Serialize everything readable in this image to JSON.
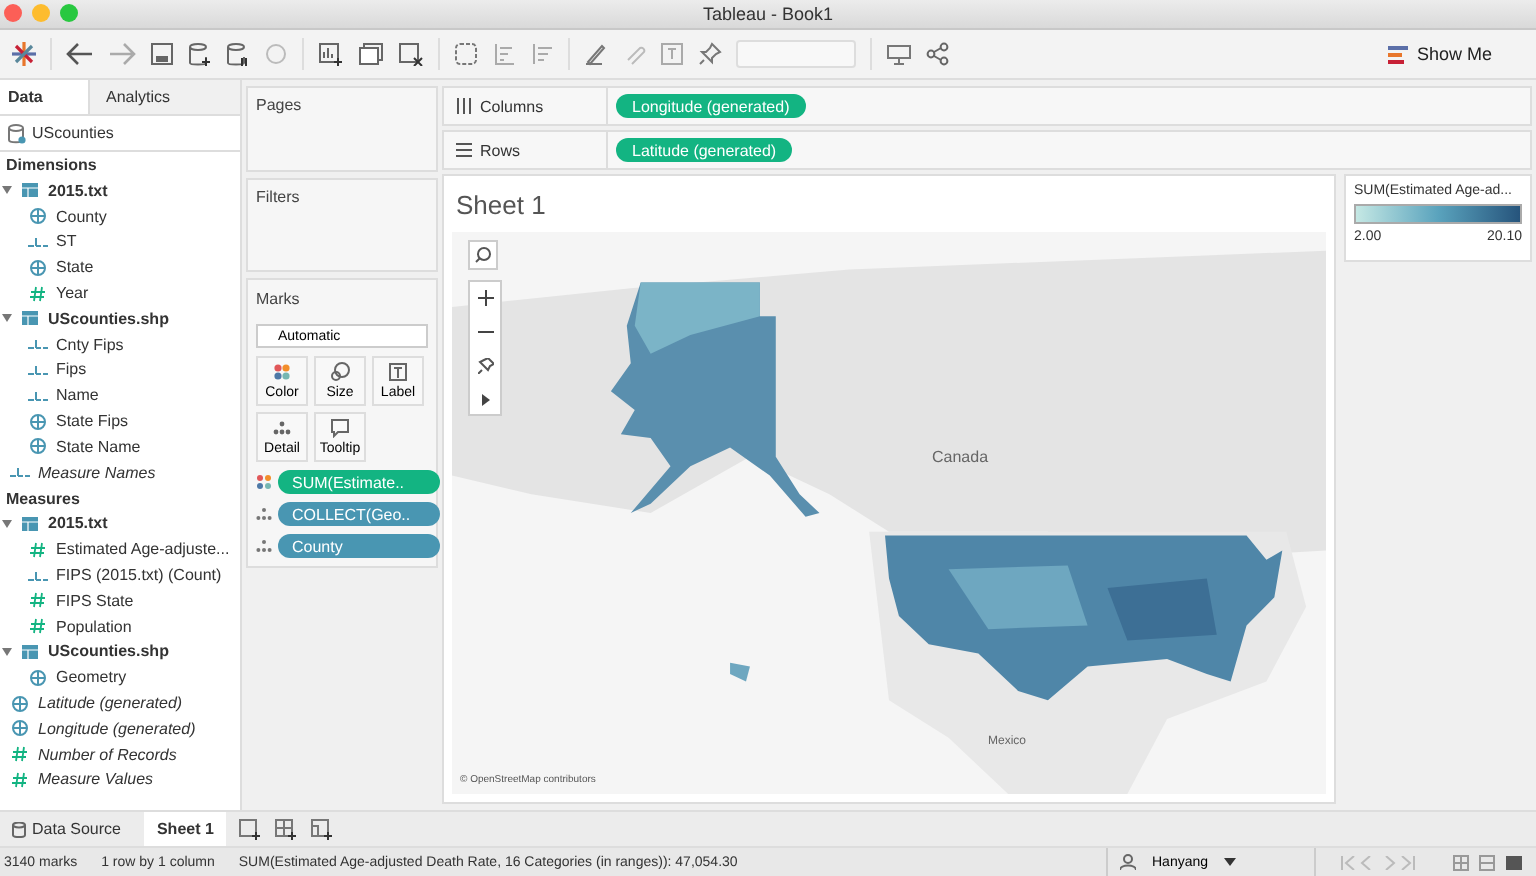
{
  "window": {
    "title": "Tableau - Book1"
  },
  "toolbar": {
    "show_me": "Show Me"
  },
  "side_tabs": [
    {
      "label": "Data",
      "selected": true
    },
    {
      "label": "Analytics",
      "selected": false
    }
  ],
  "datasource": "UScounties",
  "dimensions": {
    "title": "Dimensions",
    "items": [
      {
        "label": "2015.txt",
        "kind": "table",
        "italic": false,
        "children": [
          {
            "label": "County",
            "kind": "globe",
            "italic": false
          },
          {
            "label": "ST",
            "kind": "abc",
            "italic": false
          },
          {
            "label": "State",
            "kind": "globe",
            "italic": false
          },
          {
            "label": "Year",
            "kind": "number",
            "italic": false
          }
        ]
      },
      {
        "label": "UScounties.shp",
        "kind": "table",
        "italic": false,
        "children": [
          {
            "label": "Cnty Fips",
            "kind": "abc",
            "italic": false
          },
          {
            "label": "Fips",
            "kind": "abc",
            "italic": false
          },
          {
            "label": "Name",
            "kind": "abc",
            "italic": false
          },
          {
            "label": "State Fips",
            "kind": "globe",
            "italic": false
          },
          {
            "label": "State Name",
            "kind": "globe",
            "italic": false
          }
        ]
      },
      {
        "label": "Measure Names",
        "kind": "abc",
        "italic": true
      }
    ]
  },
  "measures": {
    "title": "Measures",
    "items": [
      {
        "label": "2015.txt",
        "kind": "table",
        "italic": false,
        "children": [
          {
            "label": "Estimated Age-adjuste...",
            "kind": "number",
            "italic": false
          },
          {
            "label": "FIPS (2015.txt) (Count)",
            "kind": "abc",
            "italic": false
          },
          {
            "label": "FIPS State",
            "kind": "number",
            "italic": false
          },
          {
            "label": "Population",
            "kind": "number",
            "italic": false
          }
        ]
      },
      {
        "label": "UScounties.shp",
        "kind": "table",
        "italic": false,
        "children": [
          {
            "label": "Geometry",
            "kind": "globe",
            "italic": false
          }
        ]
      },
      {
        "label": "Latitude (generated)",
        "kind": "globe",
        "italic": true
      },
      {
        "label": "Longitude (generated)",
        "kind": "globe",
        "italic": true
      },
      {
        "label": "Number of Records",
        "kind": "number",
        "italic": true
      },
      {
        "label": "Measure Values",
        "kind": "number",
        "italic": true
      }
    ]
  },
  "pages": {
    "title": "Pages"
  },
  "filters": {
    "title": "Filters"
  },
  "marks": {
    "title": "Marks",
    "type": "Automatic",
    "buttons": [
      {
        "label": "Color",
        "kind": "color"
      },
      {
        "label": "Size",
        "kind": "size"
      },
      {
        "label": "Label",
        "kind": "label"
      },
      {
        "label": "Detail",
        "kind": "detail"
      },
      {
        "label": "Tooltip",
        "kind": "tooltip"
      }
    ],
    "pills": [
      {
        "label": "SUM(Estimate..",
        "kind": "color",
        "color": "#13b482"
      },
      {
        "label": "COLLECT(Geo..",
        "kind": "detail",
        "color": "#4996b2"
      },
      {
        "label": "County",
        "kind": "detail",
        "color": "#4996b2"
      }
    ]
  },
  "shelves": [
    {
      "label": "Columns",
      "kind": "columns",
      "pill": "Longitude (generated)"
    },
    {
      "label": "Rows",
      "kind": "rows",
      "pill": "Latitude (generated)"
    }
  ],
  "sheet": {
    "title": "Sheet 1",
    "map_labels": [
      {
        "label": "Canada"
      },
      {
        "label": "Mexico"
      }
    ],
    "attribution": "© OpenStreetMap contributors"
  },
  "legend": {
    "title": "SUM(Estimated Age-ad...",
    "min": "2.00",
    "max": "20.10"
  },
  "sheet_tabs": [
    {
      "label": "Data Source",
      "kind": "source",
      "selected": false
    },
    {
      "label": "Sheet 1",
      "kind": "sheet",
      "selected": true
    }
  ],
  "status_bar": {
    "marks": "3140 marks",
    "dims": "1 row by 1 column",
    "sum": "SUM(Estimated Age-adjusted Death Rate, 16 Categories (in ranges)): 47,054.30",
    "user": "Hanyang"
  }
}
